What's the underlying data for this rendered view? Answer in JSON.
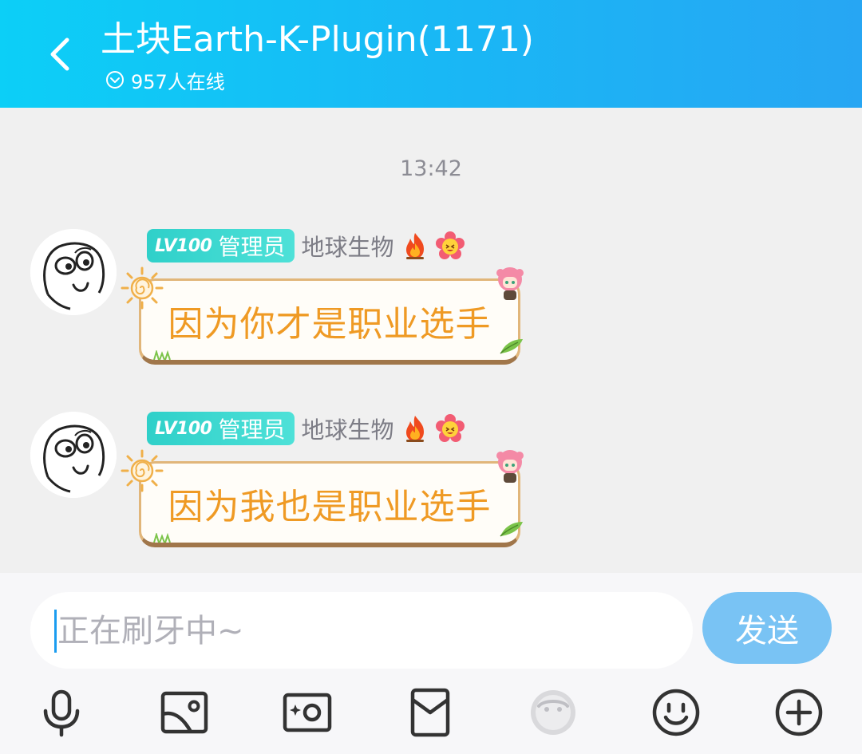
{
  "header": {
    "title": "土块Earth-K-Plugin(1171)",
    "online": "957人在线",
    "back_icon": "chevron-left-icon",
    "online_icon": "chevron-down-circle-icon"
  },
  "chat": {
    "timestamp": "13:42",
    "messages": [
      {
        "level": "LV100",
        "role": "管理员",
        "nickname": "地球生物",
        "text": "因为你才是职业选手"
      },
      {
        "level": "LV100",
        "role": "管理员",
        "nickname": "地球生物",
        "text": "因为我也是职业选手"
      }
    ]
  },
  "input": {
    "placeholder": "正在刷牙中~",
    "send_label": "发送"
  },
  "toolbar": {
    "icons": [
      "microphone-icon",
      "image-icon",
      "camera-icon",
      "red-packet-icon",
      "game-icon",
      "emoji-icon",
      "plus-icon"
    ]
  },
  "colors": {
    "header_start": "#0ccff7",
    "header_end": "#27a6f3",
    "badge": "#2fd0c9",
    "bubble_text": "#ef9a24",
    "send_button": "#79c3f4"
  }
}
